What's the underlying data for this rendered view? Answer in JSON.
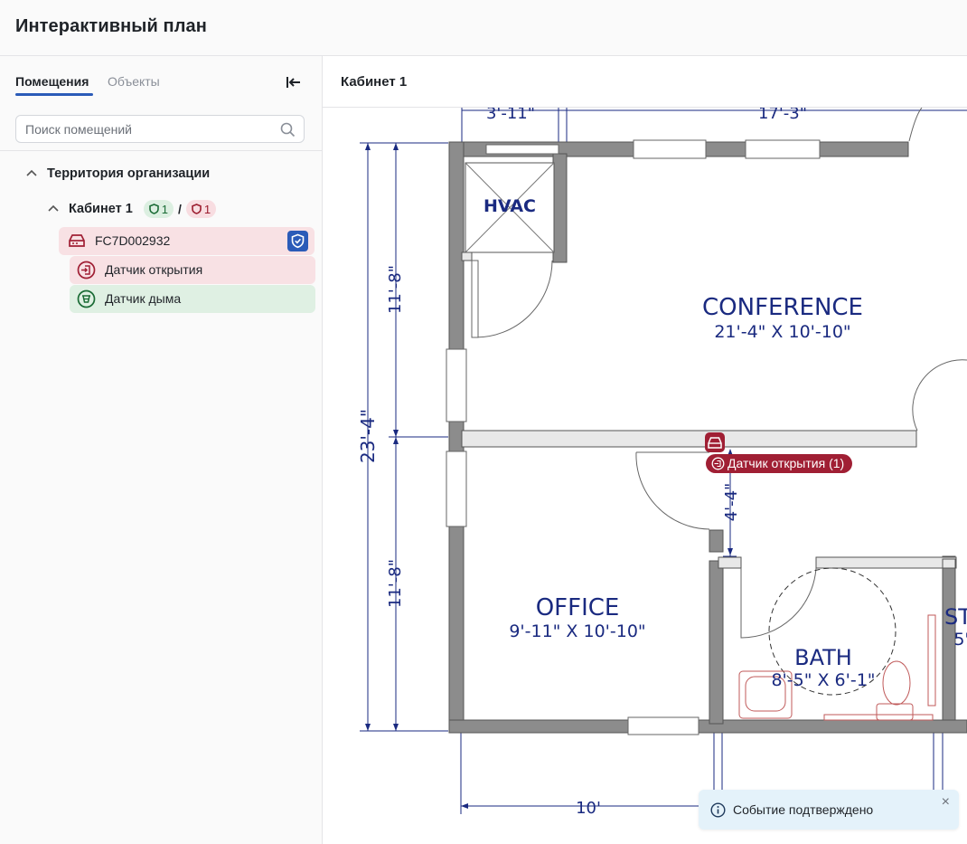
{
  "header": {
    "title": "Интерактивный план"
  },
  "sidebar": {
    "tabs": [
      {
        "label": "Помещения"
      },
      {
        "label": "Объекты"
      }
    ],
    "search": {
      "placeholder": "Поиск помещений"
    },
    "tree": {
      "territory": {
        "label": "Территория организации"
      },
      "room": {
        "label": "Кабинет 1",
        "ok_count": "1",
        "separator": "/",
        "alarm_count": "1"
      },
      "device": {
        "label": "FC7D002932"
      },
      "sensors": [
        {
          "label": "Датчик открытия",
          "status": "alarm"
        },
        {
          "label": "Датчик дыма",
          "status": "ok"
        }
      ]
    }
  },
  "main": {
    "title": "Кабинет 1"
  },
  "plan": {
    "rooms": [
      {
        "name": "HVAC",
        "size": ""
      },
      {
        "name": "CONFERENCE",
        "size": "21'-4\" X 10'-10\""
      },
      {
        "name": "OFFICE",
        "size": "9'-11\" X 10'-10\""
      },
      {
        "name": "BATH",
        "size": "8'-5\" X 6'-1\""
      },
      {
        "name": "ST",
        "size": "5'"
      }
    ],
    "dimensions": [
      "3'-11\"",
      "17'-3\"",
      "11'-8\"",
      "23'-4\"",
      "11'-8\"",
      "4'-4\"",
      "10'"
    ],
    "marker": {
      "label": "Датчик открытия (1)"
    }
  },
  "toast": {
    "text": "Событие подтверждено",
    "close": "×"
  },
  "colors": {
    "accent": "#2b5bb8",
    "alarm": "#a01f34",
    "ok": "#1a6b35",
    "blueprint": "#1a2a80"
  }
}
